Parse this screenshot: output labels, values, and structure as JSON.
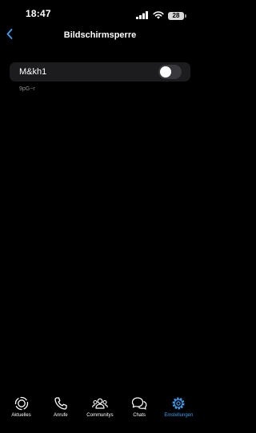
{
  "status_bar": {
    "time": "18:47",
    "battery_level": "28",
    "icons": [
      "signal-icon",
      "wifi-icon",
      "battery-icon"
    ]
  },
  "nav": {
    "title": "Bildschirmsperre",
    "back_icon": "chevron-left-icon"
  },
  "setting": {
    "label": "M&kh1",
    "toggle_on": false,
    "note": "9pG~r"
  },
  "tabs": [
    {
      "label": "Aktuelles",
      "icon": "updates-icon",
      "active": false
    },
    {
      "label": "Anrufe",
      "icon": "phone-icon",
      "active": false
    },
    {
      "label": "Communitys",
      "icon": "communities-icon",
      "active": false
    },
    {
      "label": "Chats",
      "icon": "chats-icon",
      "active": false
    },
    {
      "label": "Einstellungen",
      "icon": "settings-icon",
      "active": true
    }
  ],
  "colors": {
    "background": "#000000",
    "card": "#1c1c1e",
    "accent": "#3e9ff2",
    "toggle_off": "#39393d",
    "secondary_text": "#8e8e93"
  }
}
